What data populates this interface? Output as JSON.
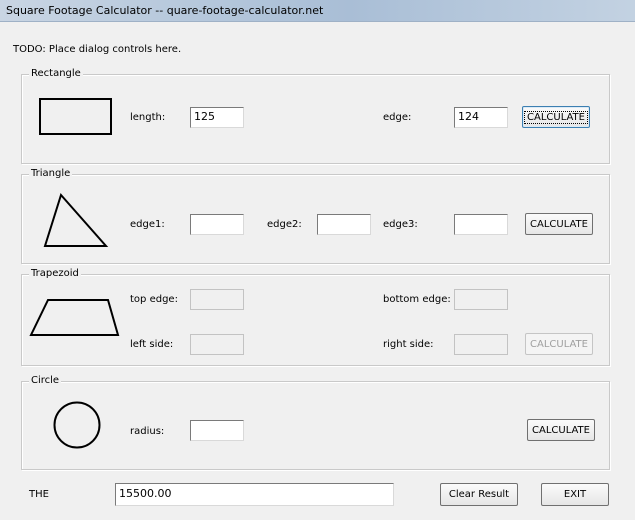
{
  "window": {
    "title": "Square Footage Calculator --  quare-footage-calculator.net",
    "todo": "TODO: Place dialog controls here."
  },
  "rectangle": {
    "group_label": "Rectangle",
    "length_label": "length:",
    "length_value": "125",
    "edge_label": "edge:",
    "edge_value": "124",
    "button": "CALCULATE"
  },
  "triangle": {
    "group_label": "Triangle",
    "edge1_label": "edge1:",
    "edge2_label": "edge2:",
    "edge3_label": "edge3:",
    "edge1_value": "",
    "edge2_value": "",
    "edge3_value": "",
    "button": "CALCULATE"
  },
  "trapezoid": {
    "group_label": "Trapezoid",
    "top_label": "top edge:",
    "bottom_label": "bottom edge:",
    "left_label": "left side:",
    "right_label": "right side:",
    "button": "CALCULATE"
  },
  "circle": {
    "group_label": "Circle",
    "radius_label": "radius:",
    "radius_value": "",
    "button": "CALCULATE"
  },
  "footer": {
    "the_label": "THE",
    "result_value": "15500.00",
    "clear_button": "Clear Result",
    "exit_button": "EXIT"
  }
}
